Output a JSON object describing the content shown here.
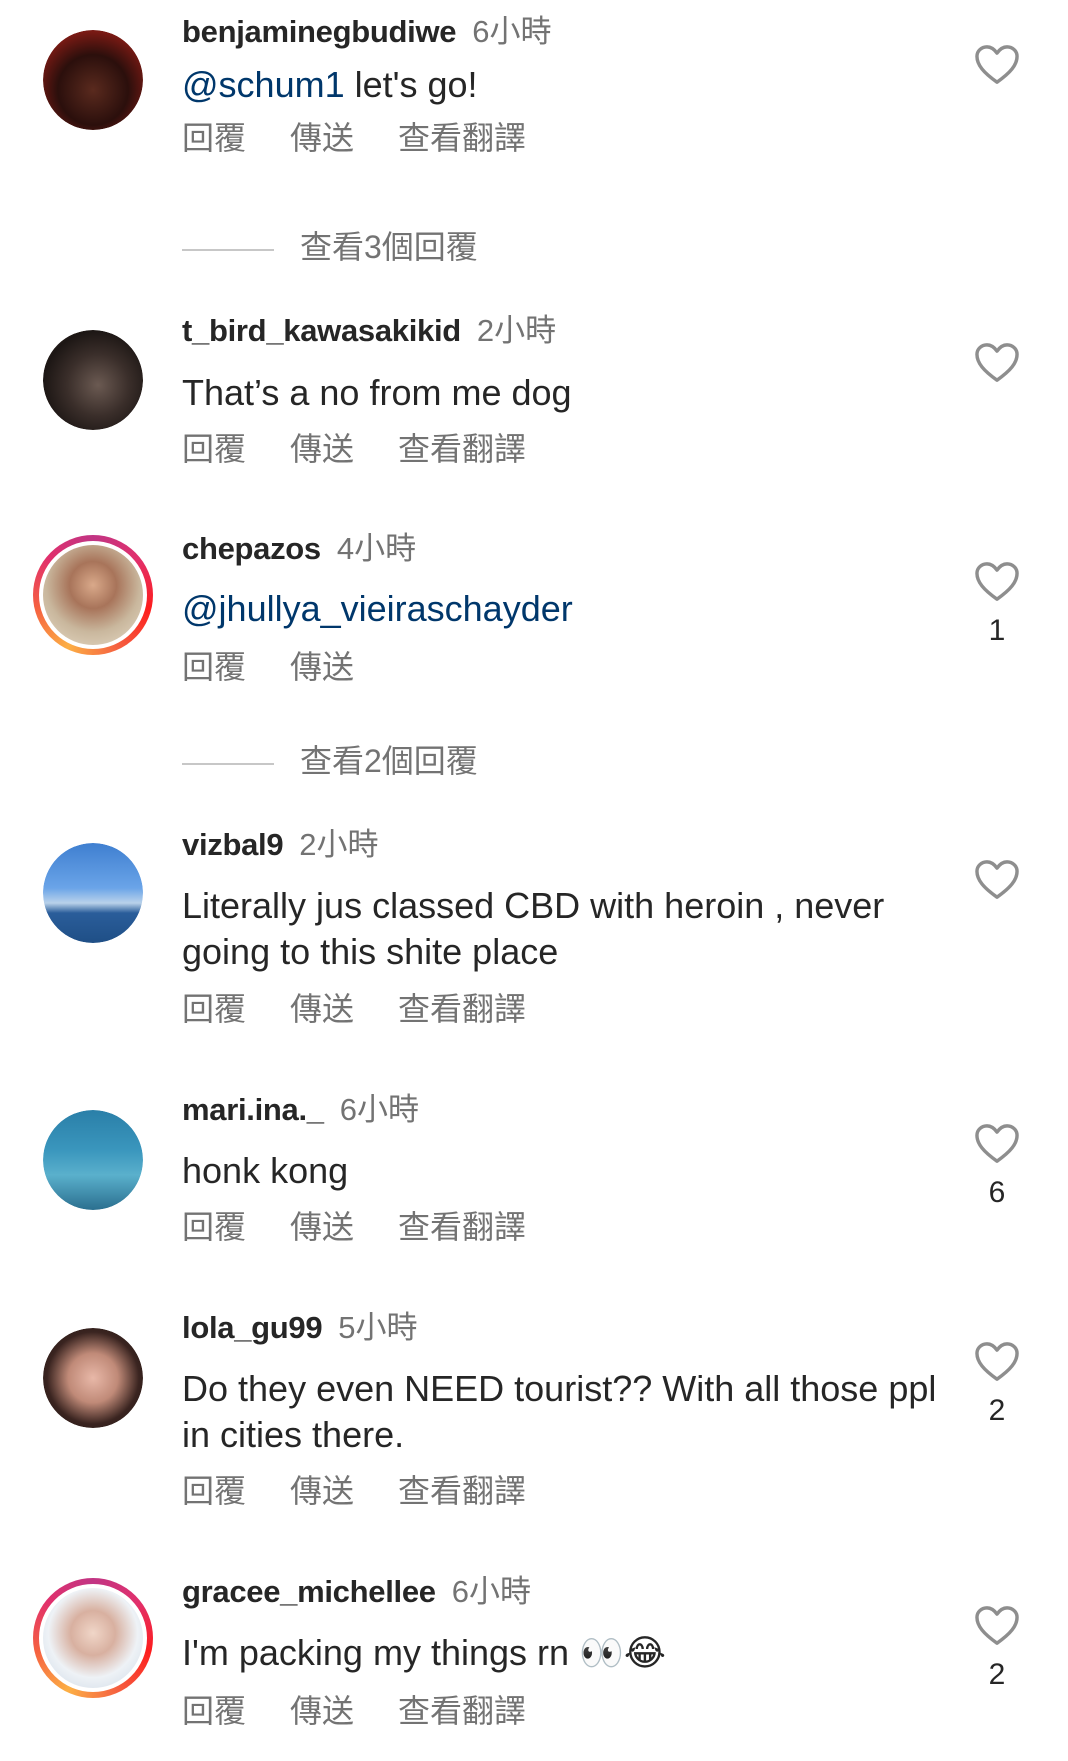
{
  "comments": [
    {
      "username": "benjaminegbudiwe",
      "time": "6小時",
      "mention": "@schum1",
      "text": " let's go!",
      "likes": "",
      "actions": {
        "reply": "回覆",
        "send": "傳送",
        "translate": "查看翻譯"
      }
    },
    {
      "username": "t_bird_kawasakikid",
      "time": "2小時",
      "mention": "",
      "text": "That’s a no from me dog",
      "likes": "",
      "actions": {
        "reply": "回覆",
        "send": "傳送",
        "translate": "查看翻譯"
      }
    },
    {
      "username": "chepazos",
      "time": "4小時",
      "mention": "@jhullya_vieiraschayder",
      "text": "",
      "likes": "1",
      "actions": {
        "reply": "回覆",
        "send": "傳送",
        "translate": ""
      }
    },
    {
      "username": "vizbal9",
      "time": "2小時",
      "mention": "",
      "text": "Literally jus classed CBD with heroin , never going to this shite place",
      "likes": "",
      "actions": {
        "reply": "回覆",
        "send": "傳送",
        "translate": "查看翻譯"
      }
    },
    {
      "username": "mari.ina._",
      "time": "6小時",
      "mention": "",
      "text": "honk kong",
      "likes": "6",
      "actions": {
        "reply": "回覆",
        "send": "傳送",
        "translate": "查看翻譯"
      }
    },
    {
      "username": "lola_gu99",
      "time": "5小時",
      "mention": "",
      "text": "Do they even NEED tourist?? With all those ppl in cities there.",
      "likes": "2",
      "actions": {
        "reply": "回覆",
        "send": "傳送",
        "translate": "查看翻譯"
      }
    },
    {
      "username": "gracee_michellee",
      "time": "6小時",
      "mention": "",
      "text": "I'm packing my things rn 👀😂",
      "likes": "2",
      "actions": {
        "reply": "回覆",
        "send": "傳送",
        "translate": "查看翻譯"
      }
    }
  ],
  "view_replies": [
    "查看3個回覆",
    "查看2個回覆"
  ],
  "icons": {
    "like": "heart-outline-icon"
  },
  "colors": {
    "mention": "#00376b",
    "muted": "#737373",
    "text": "#262626"
  }
}
